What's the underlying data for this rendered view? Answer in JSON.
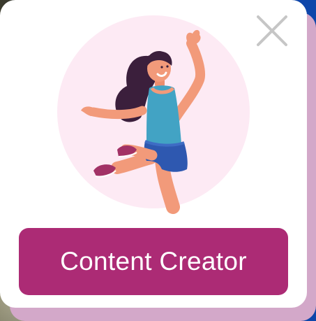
{
  "dialog": {
    "cta_label": "Content Creator",
    "close_icon": "close-icon",
    "illustration": "jumping-woman-illustration"
  },
  "colors": {
    "cta_background": "#ac2b75",
    "card_background": "#ffffff",
    "card_shadow": "#d3a8c9",
    "illustration_backdrop": "#fde9f4",
    "close_icon": "#c6c6c6"
  }
}
